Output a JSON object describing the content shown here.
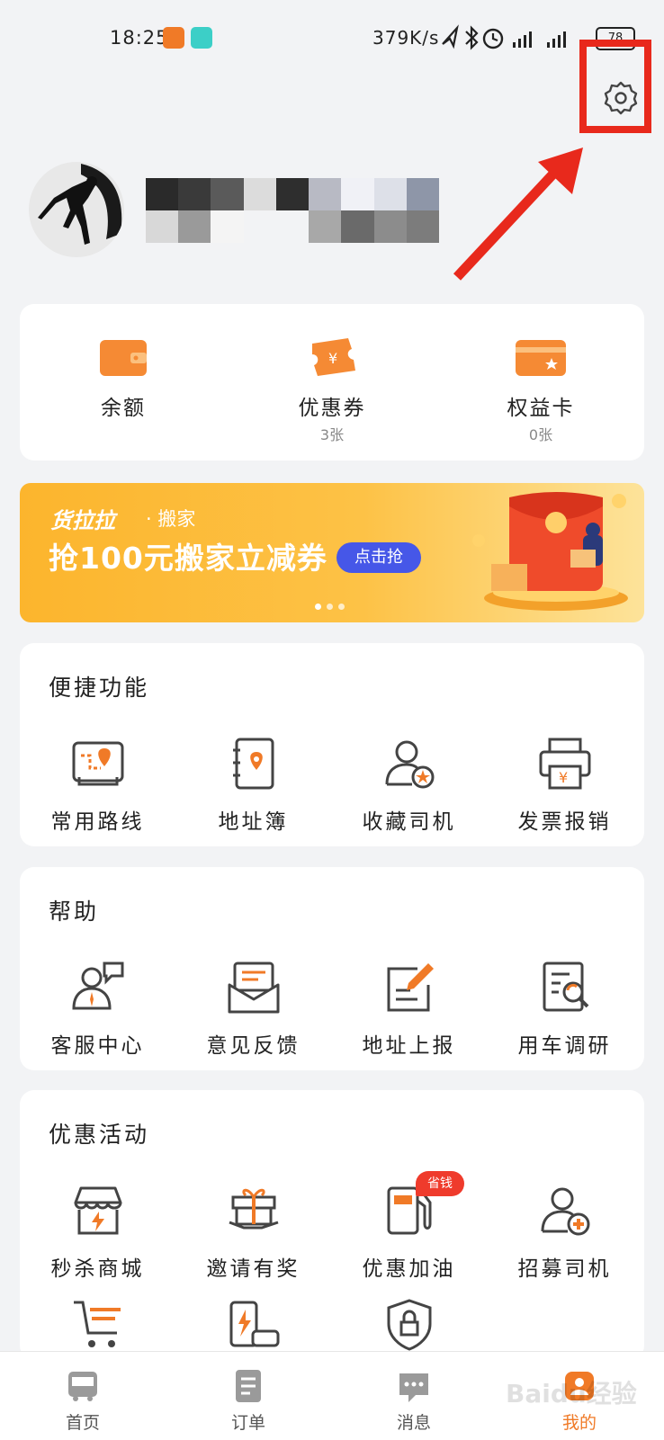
{
  "status": {
    "time": "18:25",
    "speed": "379K/s",
    "battery": "78"
  },
  "wallet": [
    {
      "label": "余额",
      "sub": ""
    },
    {
      "label": "优惠券",
      "sub": "3张"
    },
    {
      "label": "权益卡",
      "sub": "0张"
    }
  ],
  "banner": {
    "brand": "货拉拉",
    "sub": "· 搬家",
    "title": "抢100元搬家立减券",
    "button": "点击抢"
  },
  "quick": {
    "title": "便捷功能",
    "items": [
      "常用路线",
      "地址簿",
      "收藏司机",
      "发票报销"
    ]
  },
  "help": {
    "title": "帮助",
    "items": [
      "客服中心",
      "意见反馈",
      "地址上报",
      "用车调研"
    ]
  },
  "promo": {
    "title": "优惠活动",
    "items": [
      "秒杀商城",
      "邀请有奖",
      "优惠加油",
      "招募司机"
    ],
    "tag": "省钱"
  },
  "nav": [
    "首页",
    "订单",
    "消息",
    "我的"
  ],
  "colors": {
    "accent": "#f07a27",
    "highlight": "#e8291c",
    "banner_button": "#4657e8"
  },
  "watermark": "Baidu经验"
}
